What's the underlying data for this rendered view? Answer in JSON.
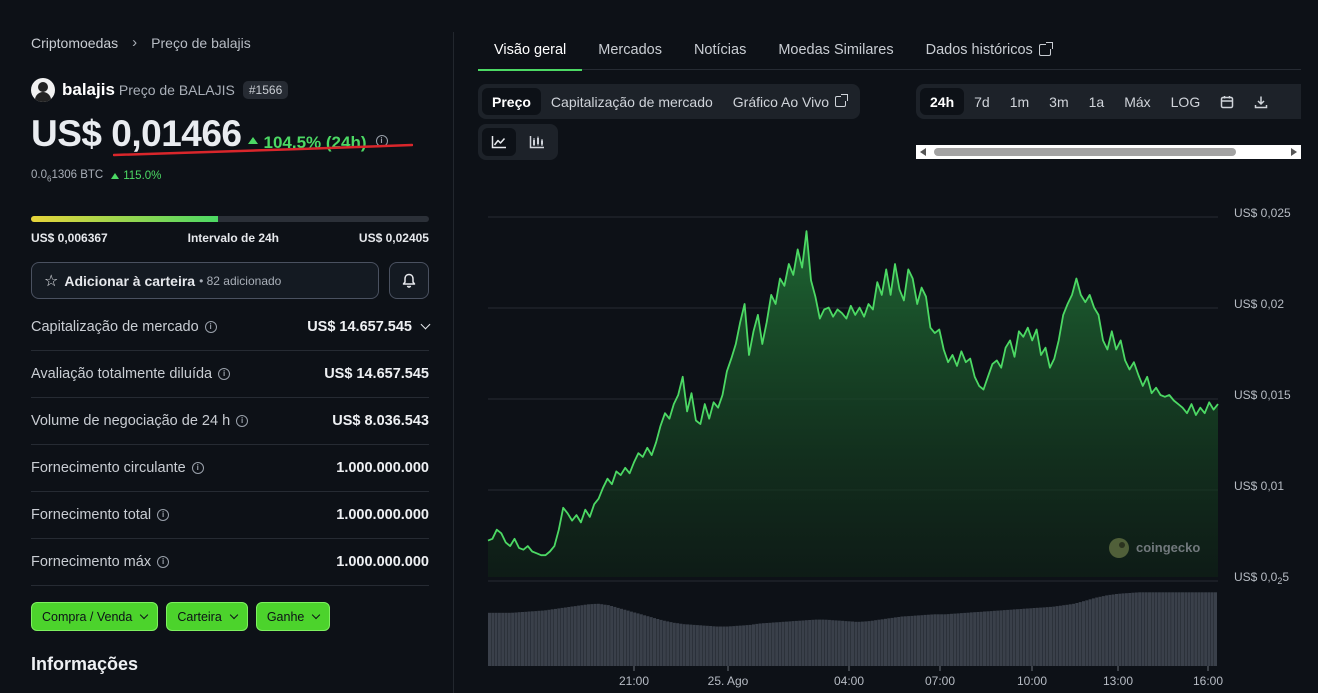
{
  "breadcrumb": {
    "root": "Criptomoedas",
    "current": "Preço de balajis"
  },
  "coin": {
    "name": "balajis",
    "subtitle": "Preço de BALAJIS",
    "rank": "#1566",
    "price": "US$ 0,01466",
    "change_24h": "104.5% (24h)",
    "btc_price_pre": "0.0",
    "btc_price_sub": "6",
    "btc_price_post": "1306 BTC",
    "btc_change": "115.0%",
    "colors": {
      "up": "#4cd964",
      "underline": "#d9262b"
    }
  },
  "range_24h": {
    "low": "US$ 0,006367",
    "label": "Intervalo de 24h",
    "high": "US$ 0,02405",
    "position": 0.47
  },
  "wallet": {
    "label": "Adicionar à carteira",
    "count": "• 82 adicionado",
    "icon": "star-icon",
    "bell_icon": "bell-icon"
  },
  "stats": [
    {
      "label": "Capitalização de mercado",
      "value": "US$ 14.657.545",
      "expand": true
    },
    {
      "label": "Avaliação totalmente diluída",
      "value": "US$ 14.657.545"
    },
    {
      "label": "Volume de negociação de 24 h",
      "value": "US$ 8.036.543"
    },
    {
      "label": "Fornecimento circulante",
      "value": "1.000.000.000"
    },
    {
      "label": "Fornecimento total",
      "value": "1.000.000.000"
    },
    {
      "label": "Fornecimento máx",
      "value": "1.000.000.000"
    }
  ],
  "actions": [
    {
      "label": "Compra / Venda"
    },
    {
      "label": "Carteira"
    },
    {
      "label": "Ganhe"
    }
  ],
  "info_title": "Informações",
  "tabs": [
    "Visão geral",
    "Mercados",
    "Notícias",
    "Moedas Similares",
    "Dados históricos"
  ],
  "active_tab": 0,
  "chart_types": [
    "Preço",
    "Capitalização de mercado",
    "Gráfico Ao Vivo"
  ],
  "active_chart_type": 0,
  "ranges": [
    "24h",
    "7d",
    "1m",
    "3m",
    "1a",
    "Máx",
    "LOG"
  ],
  "active_range": 0,
  "view_icons": [
    "line-chart-icon",
    "candlestick-chart-icon"
  ],
  "range_icons": [
    "calendar-icon",
    "download-icon"
  ],
  "watermark": "coingecko",
  "chart_data": {
    "type": "area",
    "series": [
      {
        "values": [
          0.007,
          0.0071,
          0.0076,
          0.0074,
          0.0069,
          0.0067,
          0.0071,
          0.0066,
          0.0065,
          0.0067,
          0.0064,
          0.0063,
          0.0062,
          0.0062,
          0.0064,
          0.0067,
          0.0076,
          0.0088,
          0.0085,
          0.0081,
          0.0084,
          0.008,
          0.0087,
          0.0083,
          0.009,
          0.0093,
          0.0099,
          0.0104,
          0.0101,
          0.0108,
          0.0106,
          0.011,
          0.0107,
          0.0113,
          0.0118,
          0.0116,
          0.0121,
          0.0117,
          0.0124,
          0.0133,
          0.014,
          0.0137,
          0.0145,
          0.015,
          0.016,
          0.0141,
          0.0151,
          0.0136,
          0.0134,
          0.0145,
          0.0137,
          0.0146,
          0.0143,
          0.015,
          0.0163,
          0.017,
          0.0178,
          0.019,
          0.02,
          0.0172,
          0.0185,
          0.0194,
          0.0178,
          0.019,
          0.0205,
          0.02,
          0.0214,
          0.021,
          0.0222,
          0.0216,
          0.023,
          0.022,
          0.024,
          0.0213,
          0.0204,
          0.0192,
          0.0197,
          0.0198,
          0.0193,
          0.0197,
          0.0195,
          0.0192,
          0.0199,
          0.0194,
          0.0198,
          0.0193,
          0.02,
          0.0197,
          0.0212,
          0.0205,
          0.0219,
          0.0205,
          0.0222,
          0.0208,
          0.0202,
          0.0219,
          0.0214,
          0.02,
          0.0209,
          0.0204,
          0.0187,
          0.0184,
          0.0186,
          0.0175,
          0.0168,
          0.0172,
          0.0166,
          0.0174,
          0.0168,
          0.017,
          0.016,
          0.0155,
          0.0153,
          0.016,
          0.0167,
          0.0169,
          0.0165,
          0.0176,
          0.018,
          0.0171,
          0.0185,
          0.0182,
          0.0187,
          0.018,
          0.0186,
          0.0172,
          0.0176,
          0.0165,
          0.017,
          0.018,
          0.0194,
          0.02,
          0.0205,
          0.0214,
          0.0205,
          0.0201,
          0.0205,
          0.0198,
          0.0194,
          0.018,
          0.0175,
          0.0185,
          0.0175,
          0.018,
          0.0169,
          0.0164,
          0.0168,
          0.0161,
          0.0155,
          0.016,
          0.0151,
          0.0154,
          0.015,
          0.0149,
          0.015,
          0.0147,
          0.0145,
          0.0143,
          0.014,
          0.0145,
          0.0139,
          0.0143,
          0.014,
          0.0146,
          0.0142,
          0.0145
        ]
      }
    ],
    "volume_profile": [
      0.7,
      0.7,
      0.7,
      0.71,
      0.72,
      0.73,
      0.75,
      0.77,
      0.79,
      0.81,
      0.82,
      0.8,
      0.76,
      0.72,
      0.68,
      0.64,
      0.6,
      0.57,
      0.55,
      0.54,
      0.53,
      0.52,
      0.52,
      0.53,
      0.54,
      0.56,
      0.57,
      0.58,
      0.59,
      0.6,
      0.61,
      0.61,
      0.6,
      0.59,
      0.58,
      0.59,
      0.61,
      0.63,
      0.65,
      0.66,
      0.67,
      0.68,
      0.68,
      0.69,
      0.7,
      0.71,
      0.72,
      0.73,
      0.74,
      0.75,
      0.76,
      0.77,
      0.78,
      0.8,
      0.82,
      0.86,
      0.9,
      0.93,
      0.95,
      0.96,
      0.97,
      0.97,
      0.97,
      0.97,
      0.97,
      0.97,
      0.97,
      0.97
    ],
    "xticks": [
      "21:00",
      "25. Ago",
      "04:00",
      "07:00",
      "10:00",
      "13:00",
      "16:00"
    ],
    "yticks": [
      "US$ 0,025",
      "US$ 0,02",
      "US$ 0,015",
      "US$ 0,01"
    ],
    "ytick_bottom_pre": "US$ 0,0",
    "ytick_bottom_sub": "2",
    "ytick_bottom_post": "5",
    "ylim": [
      0.005,
      0.025
    ],
    "line_color": "#4cd964"
  }
}
